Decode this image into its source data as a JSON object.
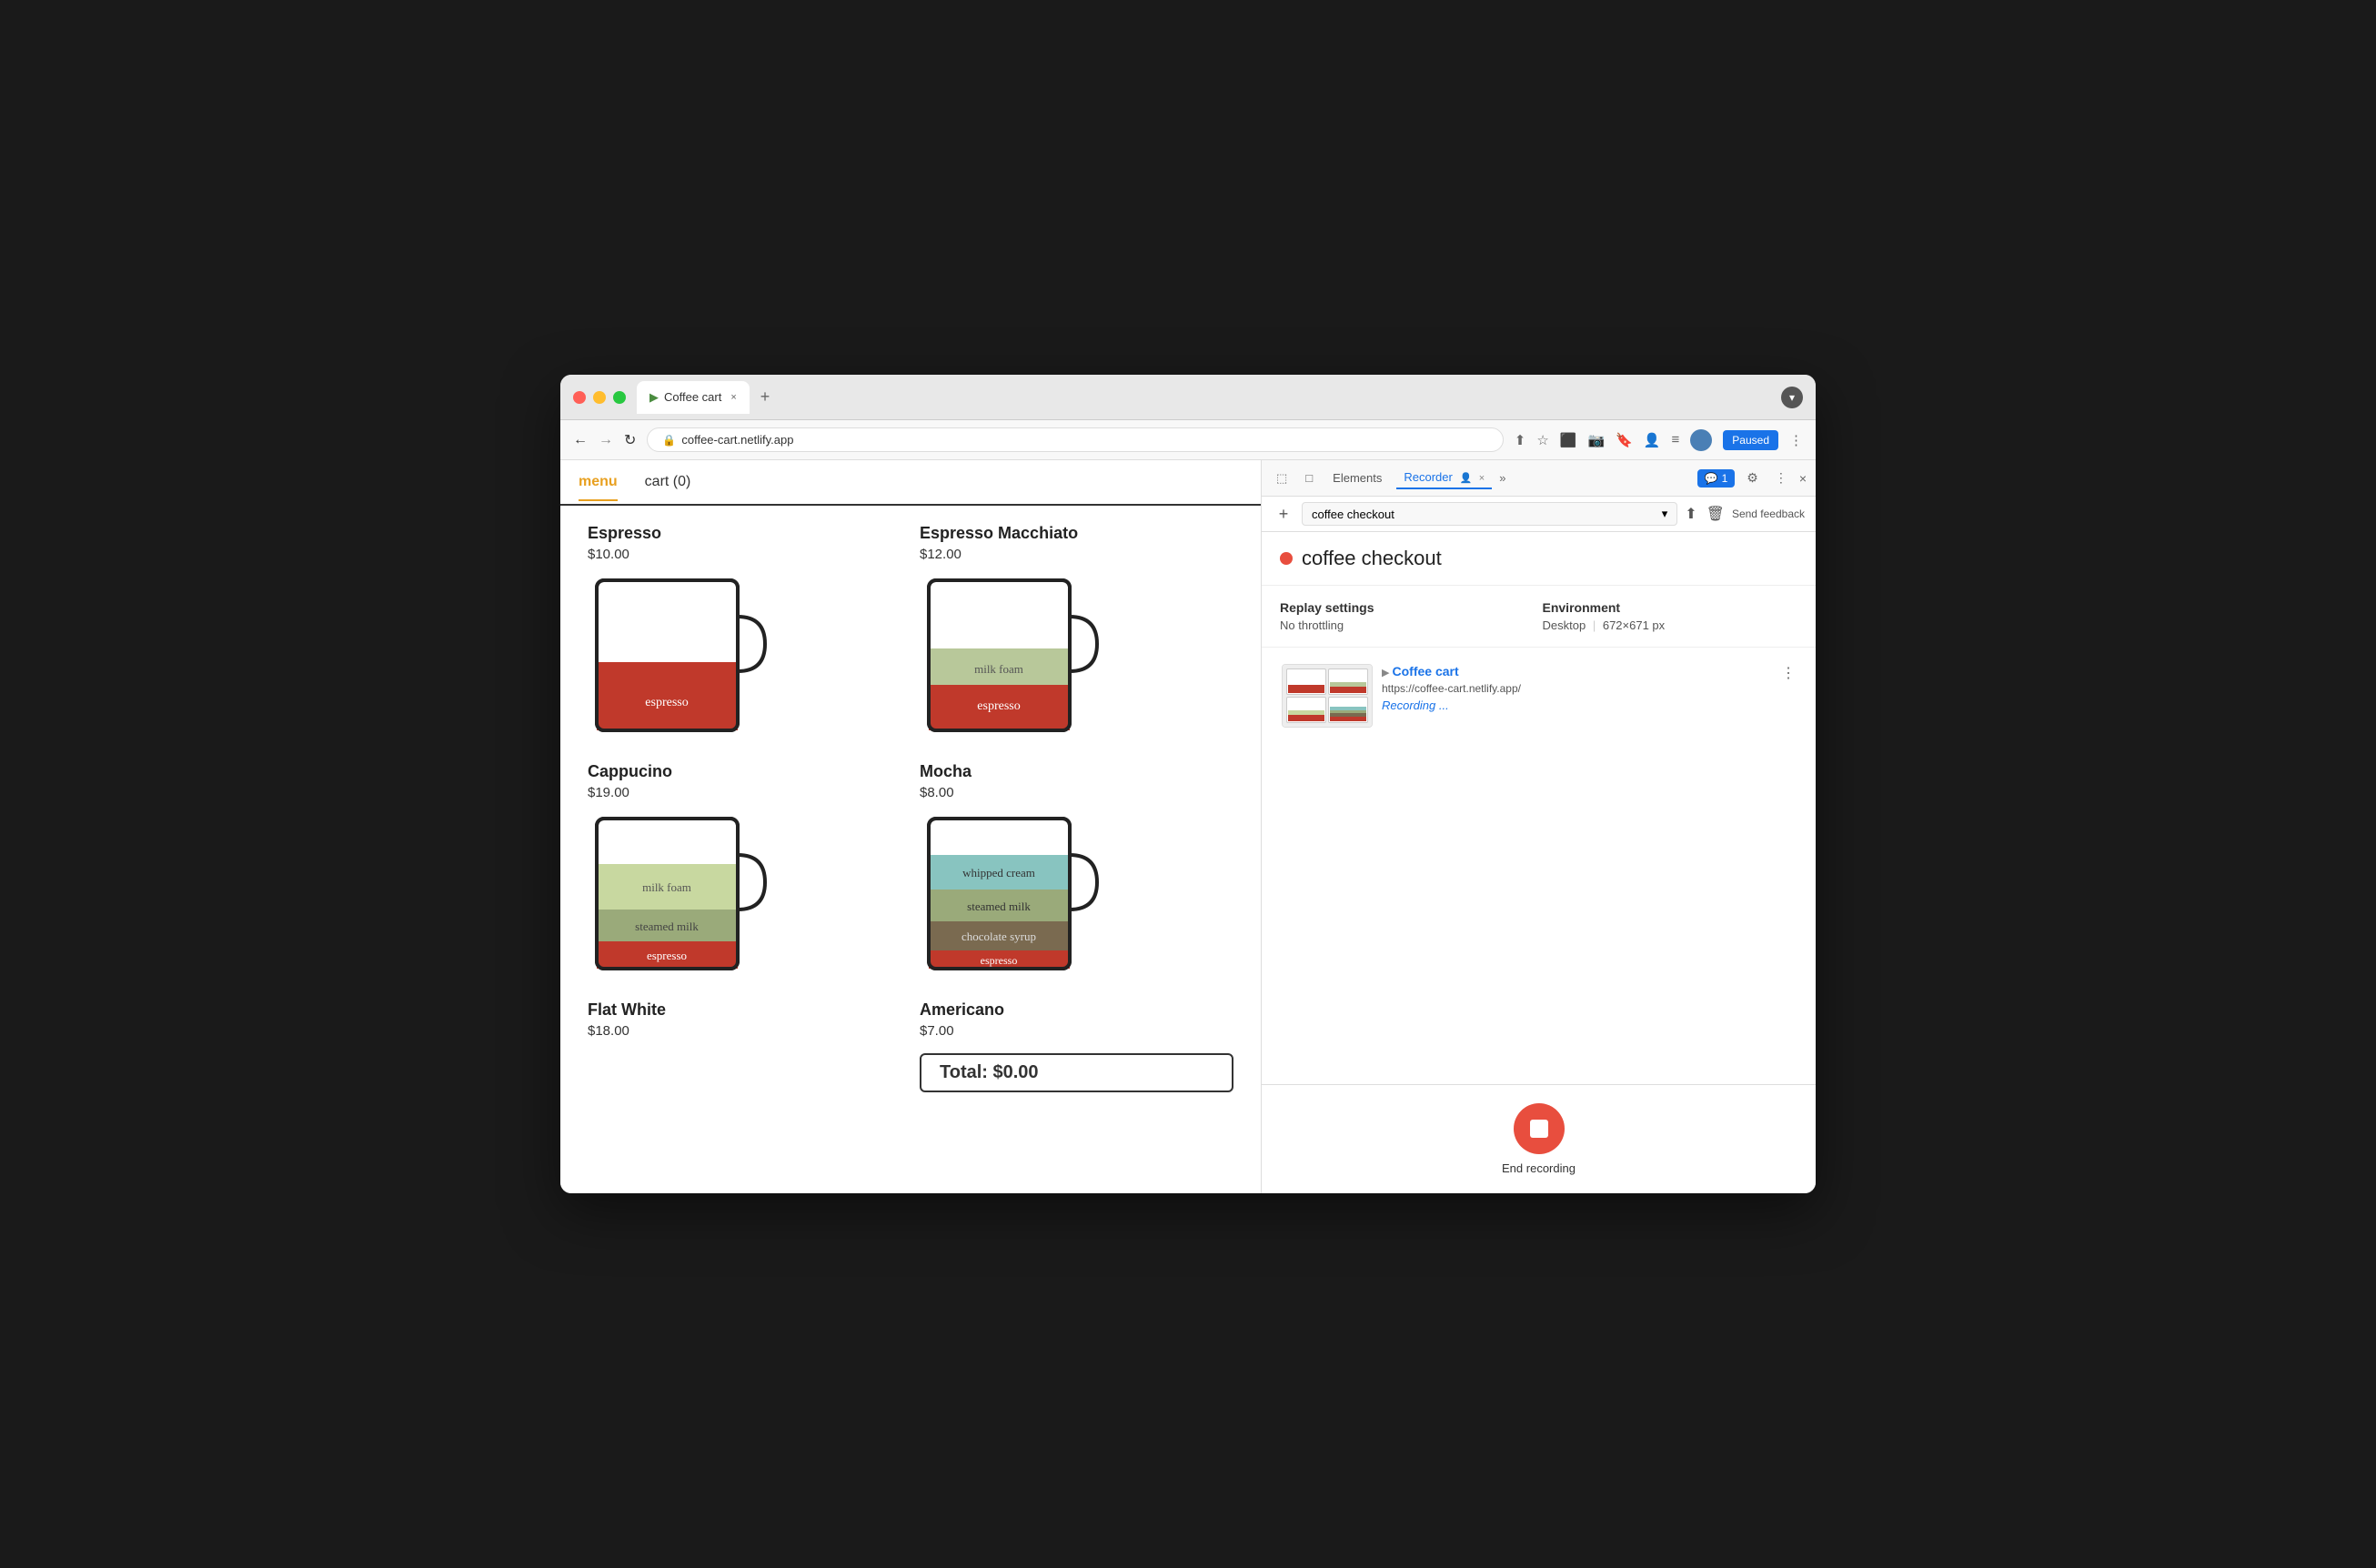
{
  "browser": {
    "tab_title": "Coffee cart",
    "tab_favicon": "▶",
    "address": "coffee-cart.netlify.app",
    "new_tab_label": "+",
    "close_tab_label": "×",
    "nav_back": "←",
    "nav_forward": "→",
    "nav_refresh": "↻",
    "paused_label": "Paused",
    "more_label": "⋮"
  },
  "shop": {
    "nav_menu": "menu",
    "nav_cart": "cart (0)",
    "items": [
      {
        "name": "Espresso",
        "price": "$10.00",
        "layers": [
          {
            "label": "espresso",
            "color": "#c0392b",
            "height": 40
          }
        ]
      },
      {
        "name": "Espresso Macchiato",
        "price": "$12.00",
        "layers": [
          {
            "label": "milk foam",
            "color": "#b8c89a",
            "height": 25
          },
          {
            "label": "espresso",
            "color": "#c0392b",
            "height": 40
          }
        ]
      },
      {
        "name": "Cappucino",
        "price": "$19.00",
        "layers": [
          {
            "label": "milk foam",
            "color": "#c8d8a0",
            "height": 30
          },
          {
            "label": "steamed milk",
            "color": "#9aaa7a",
            "height": 25
          },
          {
            "label": "espresso",
            "color": "#c0392b",
            "height": 30
          }
        ]
      },
      {
        "name": "Mocha",
        "price": "$8.00",
        "layers": [
          {
            "label": "whipped cream",
            "color": "#88c4c0",
            "height": 22
          },
          {
            "label": "steamed milk",
            "color": "#9aaa7a",
            "height": 22
          },
          {
            "label": "chocolate syrup",
            "color": "#7a6a50",
            "height": 22
          },
          {
            "label": "espresso",
            "color": "#c0392b",
            "height": 22
          }
        ]
      },
      {
        "name": "Flat White",
        "price": "$18.00",
        "layers": []
      },
      {
        "name": "Americano",
        "price": "$7.00",
        "layers": []
      }
    ],
    "total_label": "Total: $0.00"
  },
  "devtools": {
    "toolbar": {
      "cursor_icon": "⬚",
      "layers_icon": "□",
      "elements_tab": "Elements",
      "recorder_tab": "Recorder",
      "recorder_icon": "👤",
      "close_icon": "×",
      "more_icon": "»",
      "chat_badge": "1",
      "settings_icon": "⚙",
      "kebab_icon": "⋮",
      "close_btn": "×"
    },
    "recorder_toolbar": {
      "add_icon": "+",
      "recording_name": "coffee checkout",
      "dropdown_icon": "▾",
      "upload_icon": "⬆",
      "delete_icon": "🗑",
      "feedback_label": "Send feedback"
    },
    "recording": {
      "status_dot_color": "#e84e3e",
      "title": "coffee checkout",
      "replay_settings_label": "Replay settings",
      "environment_label": "Environment",
      "throttling_label": "No throttling",
      "desktop_label": "Desktop",
      "resolution_sep": "|",
      "resolution": "672×671 px"
    },
    "step": {
      "title": "Coffee cart",
      "url": "https://coffee-cart.netlify.app/",
      "more_icon": "⋮",
      "recording_status": "Recording ..."
    },
    "bottom": {
      "end_recording_label": "End recording"
    }
  }
}
